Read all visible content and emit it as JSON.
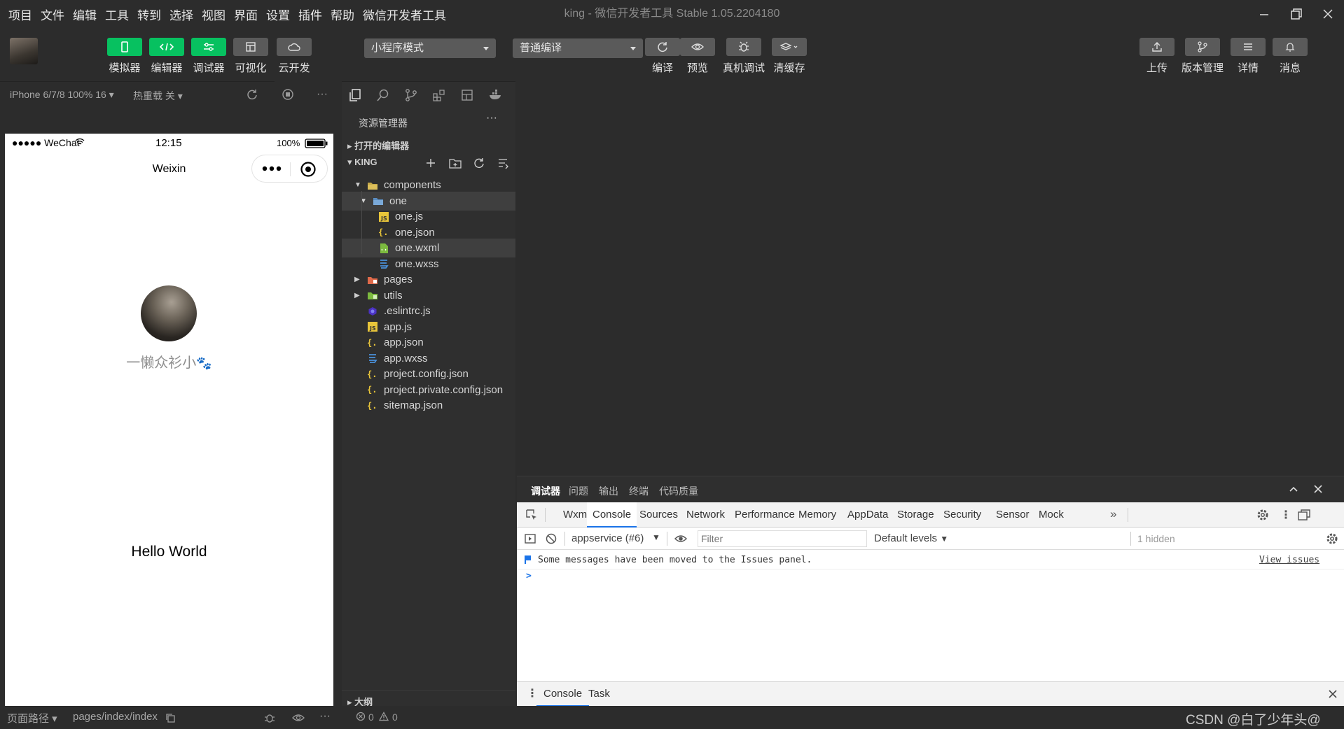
{
  "menu": [
    "项目",
    "文件",
    "编辑",
    "工具",
    "转到",
    "选择",
    "视图",
    "界面",
    "设置",
    "插件",
    "帮助",
    "微信开发者工具"
  ],
  "window_title": "king - 微信开发者工具 Stable 1.05.2204180",
  "toolbar": {
    "left_buttons": [
      {
        "label": "模拟器",
        "icon": "phone-icon"
      },
      {
        "label": "编辑器",
        "icon": "code-icon"
      },
      {
        "label": "调试器",
        "icon": "sliders-icon"
      },
      {
        "label": "可视化",
        "icon": "layout-icon"
      },
      {
        "label": "云开发",
        "icon": "cloud-icon"
      }
    ],
    "mode_select": "小程序模式",
    "compile_select": "普通编译",
    "mid_buttons": [
      {
        "label": "编译",
        "icon": "refresh-icon"
      },
      {
        "label": "预览",
        "icon": "eye-icon"
      },
      {
        "label": "真机调试",
        "icon": "bug-icon"
      },
      {
        "label": "清缓存",
        "icon": "layers-icon"
      }
    ],
    "right_buttons": [
      {
        "label": "上传",
        "icon": "upload-icon"
      },
      {
        "label": "版本管理",
        "icon": "branch-icon"
      },
      {
        "label": "详情",
        "icon": "menu-icon"
      },
      {
        "label": "消息",
        "icon": "bell-icon"
      }
    ]
  },
  "simulator": {
    "device": "iPhone 6/7/8 100% 16",
    "hot_reload": "热重载 关",
    "status": {
      "carrier": "●●●●● WeChat",
      "time": "12:15",
      "battery": "100%"
    },
    "nav_title": "Weixin",
    "nickname": "一懒众衫小",
    "hello": "Hello World",
    "footer": {
      "path_label": "页面路径",
      "path": "pages/index/index"
    }
  },
  "explorer": {
    "title": "资源管理器",
    "open_editors": "打开的编辑器",
    "project": "KING",
    "tree": [
      {
        "name": "components",
        "kind": "folder-open",
        "depth": 1,
        "expanded": true
      },
      {
        "name": "one",
        "kind": "folder-open-blue",
        "depth": 2,
        "expanded": true,
        "selected": true
      },
      {
        "name": "one.js",
        "kind": "js",
        "depth": 3
      },
      {
        "name": "one.json",
        "kind": "json",
        "depth": 3
      },
      {
        "name": "one.wxml",
        "kind": "wxml",
        "depth": 3,
        "highlighted": true
      },
      {
        "name": "one.wxss",
        "kind": "wxss",
        "depth": 3
      },
      {
        "name": "pages",
        "kind": "folder-pages",
        "depth": 1,
        "expanded": false
      },
      {
        "name": "utils",
        "kind": "folder-utils",
        "depth": 1,
        "expanded": false
      },
      {
        "name": ".eslintrc.js",
        "kind": "eslint",
        "depth": 1
      },
      {
        "name": "app.js",
        "kind": "js",
        "depth": 1
      },
      {
        "name": "app.json",
        "kind": "json",
        "depth": 1
      },
      {
        "name": "app.wxss",
        "kind": "wxss",
        "depth": 1
      },
      {
        "name": "project.config.json",
        "kind": "json",
        "depth": 1
      },
      {
        "name": "project.private.config.json",
        "kind": "json",
        "depth": 1
      },
      {
        "name": "sitemap.json",
        "kind": "json",
        "depth": 1
      }
    ],
    "outline": "大纲"
  },
  "devtools": {
    "panel_tabs": [
      "调试器",
      "问题",
      "输出",
      "终端",
      "代码质量"
    ],
    "chrome_tabs": [
      "Wxml",
      "Console",
      "Sources",
      "Network",
      "Performance",
      "Memory",
      "AppData",
      "Storage",
      "Security",
      "Sensor",
      "Mock"
    ],
    "active_chrome_tab": "Console",
    "context": "appservice (#6)",
    "filter_placeholder": "Filter",
    "levels": "Default levels",
    "hidden": "1 hidden",
    "message": "Some messages have been moved to the Issues panel.",
    "view_issues": "View issues",
    "prompt": ">",
    "drawer_tabs": [
      "Console",
      "Task"
    ]
  },
  "status": {
    "errors": "0",
    "warnings": "0"
  },
  "watermark": "CSDN @白了少年头@",
  "colors": {
    "green": "#07c160",
    "accent_blue": "#1a73e8"
  }
}
